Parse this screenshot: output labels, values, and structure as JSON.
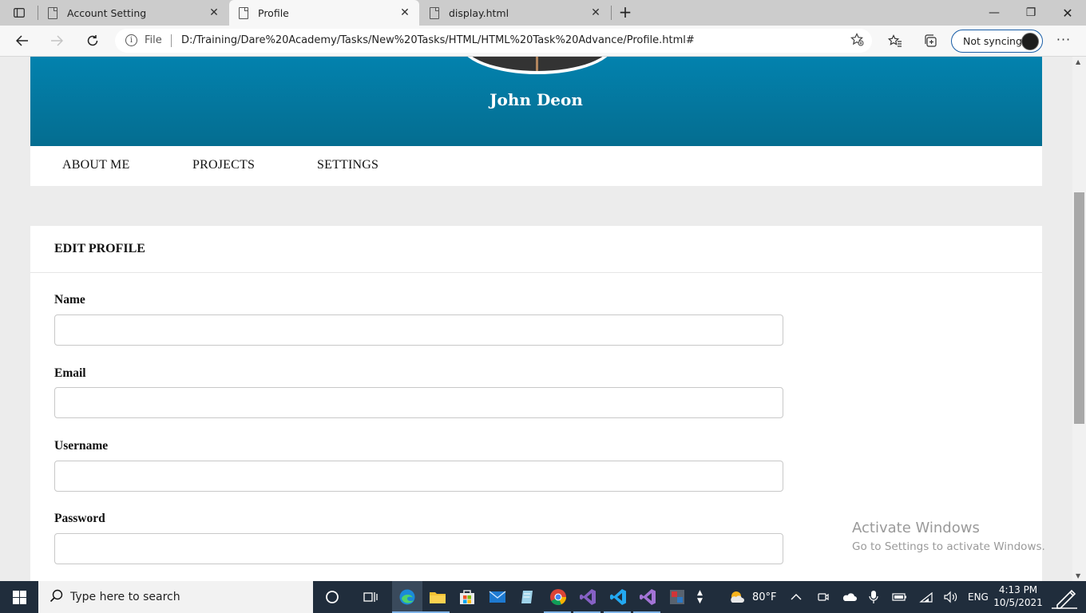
{
  "browser": {
    "tabs": [
      {
        "title": "Account Setting",
        "close": "✕"
      },
      {
        "title": "Profile",
        "close": "✕"
      },
      {
        "title": "display.html",
        "close": "✕"
      }
    ],
    "new_tab": "+",
    "window_controls": {
      "minimize": "—",
      "restore": "❐",
      "close": "✕"
    },
    "address": {
      "scheme_label": "File",
      "url": "D:/Training/Dare%20Academy/Tasks/New%20Tasks/HTML/HTML%20Task%20Advance/Profile.html#"
    },
    "profile_label": "Not syncing",
    "more": "···"
  },
  "page": {
    "profile_name": "John Deon",
    "menu": [
      "ABOUT ME",
      "PROJECTS",
      "SETTINGS"
    ],
    "card_title": "EDIT PROFILE",
    "fields": [
      "Name",
      "Email",
      "Username",
      "Password"
    ]
  },
  "watermark": {
    "title": "Activate Windows",
    "subtitle": "Go to Settings to activate Windows."
  },
  "taskbar": {
    "search_placeholder": "Type here to search",
    "weather": "80°F",
    "language": "ENG",
    "time": "4:13 PM",
    "date": "10/5/2021"
  },
  "colors": {
    "banner_top": "#0382ae",
    "banner_bottom": "#046d90",
    "taskbar": "#202d3c",
    "page_bg": "#ececec"
  }
}
